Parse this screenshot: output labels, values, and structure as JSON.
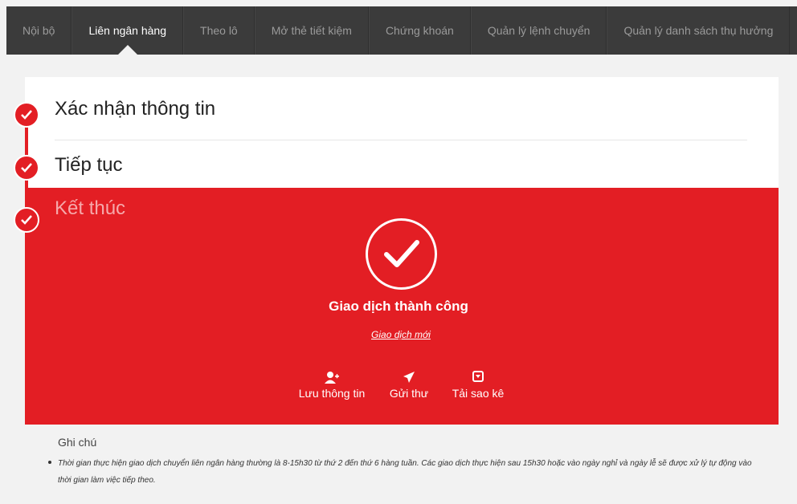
{
  "nav": {
    "tabs": [
      {
        "label": "Nội bộ",
        "active": false
      },
      {
        "label": "Liên ngân hàng",
        "active": true
      },
      {
        "label": "Theo lô",
        "active": false
      },
      {
        "label": "Mở thẻ tiết kiệm",
        "active": false
      },
      {
        "label": "Chứng khoán",
        "active": false
      },
      {
        "label": "Quản lý lệnh chuyển",
        "active": false
      },
      {
        "label": "Quản lý danh sách thụ hưởng",
        "active": false
      }
    ]
  },
  "steps": [
    {
      "label": "Xác nhận thông tin",
      "status": "done"
    },
    {
      "label": "Tiếp tục",
      "status": "done"
    },
    {
      "label": "Kết thúc",
      "status": "current"
    }
  ],
  "result": {
    "title": "Giao dịch thành công",
    "new_transaction_link": "Giao dịch mới"
  },
  "actions": [
    {
      "label": "Lưu thông tin",
      "icon": "add-user-icon"
    },
    {
      "label": "Gửi thư",
      "icon": "send-icon"
    },
    {
      "label": "Tải sao kê",
      "icon": "download-icon"
    }
  ],
  "notes": {
    "title": "Ghi chú",
    "text": "Thời gian thực hiện giao dịch chuyển liên ngân hàng thường là 8-15h30 từ thứ 2 đến thứ 6 hàng tuần. Các giao dịch thực hiện sau 15h30 hoặc vào ngày nghỉ và ngày lễ sẽ được xử lý tự động vào thời gian làm việc tiếp theo."
  },
  "colors": {
    "accent": "#e31e24",
    "topbar": "#3b3b3b",
    "background": "#f2f2f2"
  }
}
